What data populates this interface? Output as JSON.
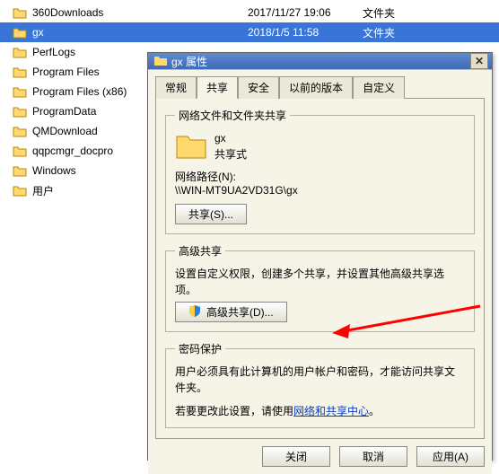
{
  "explorer": {
    "rows": [
      {
        "name": "360Downloads",
        "date": "2017/11/27 19:06",
        "type": "文件夹",
        "selected": false
      },
      {
        "name": "gx",
        "date": "2018/1/5 11:58",
        "type": "文件夹",
        "selected": true
      },
      {
        "name": "PerfLogs",
        "date": "",
        "type": "",
        "selected": false
      },
      {
        "name": "Program Files",
        "date": "",
        "type": "",
        "selected": false
      },
      {
        "name": "Program Files (x86)",
        "date": "",
        "type": "",
        "selected": false
      },
      {
        "name": "ProgramData",
        "date": "",
        "type": "",
        "selected": false
      },
      {
        "name": "QMDownload",
        "date": "",
        "type": "",
        "selected": false
      },
      {
        "name": "qqpcmgr_docpro",
        "date": "",
        "type": "",
        "selected": false
      },
      {
        "name": "Windows",
        "date": "",
        "type": "",
        "selected": false
      },
      {
        "name": "用户",
        "date": "",
        "type": "",
        "selected": false
      }
    ]
  },
  "dialog": {
    "title": "gx 属性",
    "close_glyph": "✕",
    "tabs": {
      "general": "常规",
      "sharing": "共享",
      "security": "安全",
      "versions": "以前的版本",
      "custom": "自定义"
    },
    "share_group": {
      "legend": "网络文件和文件夹共享",
      "folder_name": "gx",
      "share_state": "共享式",
      "netpath_label": "网络路径(N):",
      "netpath_value": "\\\\WIN-MT9UA2VD31G\\gx",
      "share_button": "共享(S)..."
    },
    "advanced_group": {
      "legend": "高级共享",
      "desc": "设置自定义权限，创建多个共享，并设置其他高级共享选项。",
      "button": "高级共享(D)..."
    },
    "password_group": {
      "legend": "密码保护",
      "desc": "用户必须具有此计算机的用户帐户和密码，才能访问共享文件夹。",
      "change_prefix": "若要更改此设置，请使用",
      "link": "网络和共享中心",
      "suffix": "。"
    },
    "buttons": {
      "ok": "关闭",
      "cancel": "取消",
      "apply": "应用(A)"
    }
  }
}
